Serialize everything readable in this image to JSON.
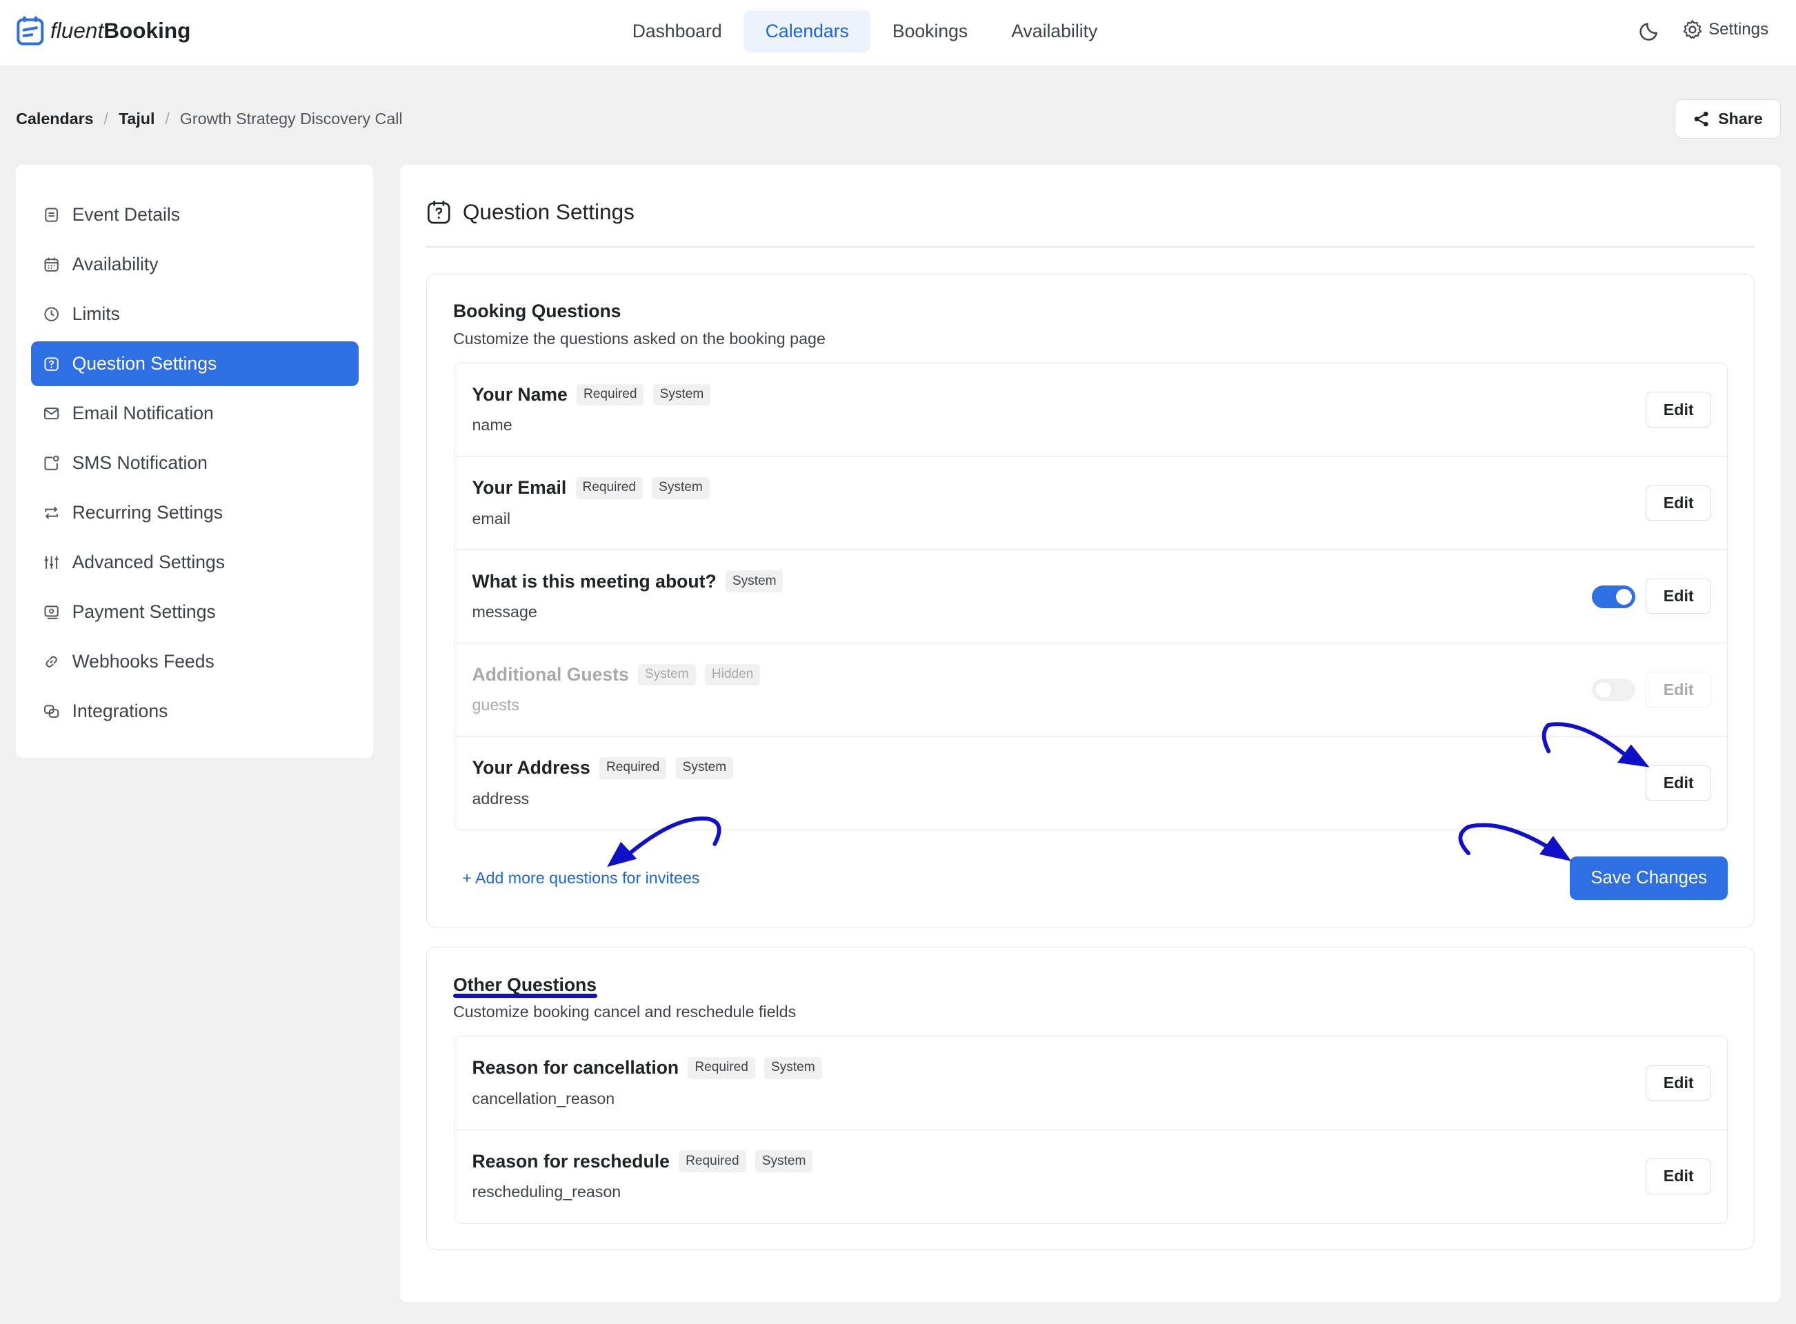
{
  "brand": {
    "part1": "fluent",
    "part2": "Booking"
  },
  "nav": [
    {
      "label": "Dashboard",
      "active": false
    },
    {
      "label": "Calendars",
      "active": true
    },
    {
      "label": "Bookings",
      "active": false
    },
    {
      "label": "Availability",
      "active": false
    }
  ],
  "topright": {
    "settings_label": "Settings"
  },
  "breadcrumb": {
    "root": "Calendars",
    "mid": "Tajul",
    "current": "Growth Strategy Discovery Call"
  },
  "share_label": "Share",
  "sidebar": [
    {
      "label": "Event Details",
      "icon": "document-icon"
    },
    {
      "label": "Availability",
      "icon": "calendar-icon"
    },
    {
      "label": "Limits",
      "icon": "clock-icon"
    },
    {
      "label": "Question Settings",
      "icon": "question-icon",
      "active": true
    },
    {
      "label": "Email Notification",
      "icon": "mail-icon"
    },
    {
      "label": "SMS Notification",
      "icon": "sms-icon"
    },
    {
      "label": "Recurring Settings",
      "icon": "repeat-icon"
    },
    {
      "label": "Advanced Settings",
      "icon": "sliders-icon"
    },
    {
      "label": "Payment Settings",
      "icon": "payment-icon"
    },
    {
      "label": "Webhooks Feeds",
      "icon": "link-icon"
    },
    {
      "label": "Integrations",
      "icon": "integrations-icon"
    }
  ],
  "main": {
    "title": "Question Settings"
  },
  "booking": {
    "title": "Booking Questions",
    "subtitle": "Customize the questions asked on the booking page",
    "edit_label": "Edit",
    "questions": [
      {
        "name": "Your Name",
        "badges": [
          "Required",
          "System"
        ],
        "key": "name"
      },
      {
        "name": "Your Email",
        "badges": [
          "Required",
          "System"
        ],
        "key": "email"
      },
      {
        "name": "What is this meeting about?",
        "badges": [
          "System"
        ],
        "key": "message",
        "toggle": "on"
      },
      {
        "name": "Additional Guests",
        "badges": [
          "System",
          "Hidden"
        ],
        "key": "guests",
        "toggle": "off",
        "dim": true
      },
      {
        "name": "Your Address",
        "badges": [
          "Required",
          "System"
        ],
        "key": "address"
      }
    ],
    "add_link": "+ Add more questions for invitees",
    "save_label": "Save Changes"
  },
  "other": {
    "title": "Other Questions",
    "subtitle": "Customize booking cancel and reschedule fields",
    "edit_label": "Edit",
    "questions": [
      {
        "name": "Reason for cancellation",
        "badges": [
          "Required",
          "System"
        ],
        "key": "cancellation_reason"
      },
      {
        "name": "Reason for reschedule",
        "badges": [
          "Required",
          "System"
        ],
        "key": "rescheduling_reason"
      }
    ]
  },
  "colors": {
    "accent": "#2f6fe4",
    "link": "#1b66d6",
    "annotation": "#1010c8"
  }
}
